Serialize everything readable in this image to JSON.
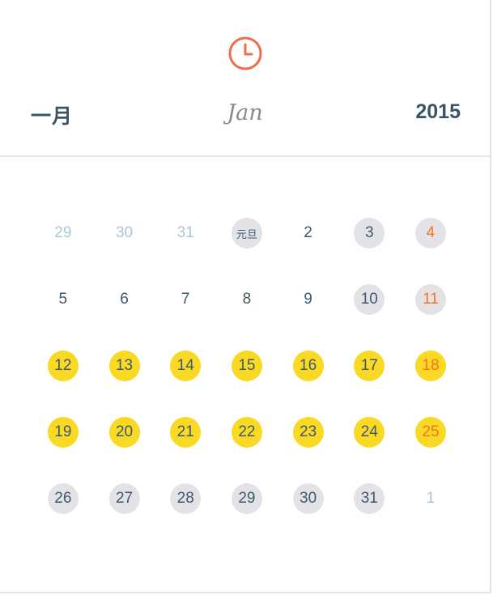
{
  "header": {
    "icon": "clock-icon",
    "month_cn": "一月",
    "month_en": "Jan",
    "year": "2015"
  },
  "colors": {
    "accent": "#f26b4a",
    "text": "#3a5566",
    "muted": "#a9c8d3",
    "highlight_yellow": "#f9d923",
    "grey_circle": "#e3e3e7",
    "weekend_orange": "#f5741f"
  },
  "calendar": {
    "weeks": [
      [
        {
          "label": "29",
          "type": "other"
        },
        {
          "label": "30",
          "type": "other"
        },
        {
          "label": "31",
          "type": "other"
        },
        {
          "label": "元旦",
          "type": "holiday"
        },
        {
          "label": "2",
          "type": "plain"
        },
        {
          "label": "3",
          "type": "grey"
        },
        {
          "label": "4",
          "type": "grey-weekend"
        }
      ],
      [
        {
          "label": "5",
          "type": "plain"
        },
        {
          "label": "6",
          "type": "plain"
        },
        {
          "label": "7",
          "type": "plain"
        },
        {
          "label": "8",
          "type": "plain"
        },
        {
          "label": "9",
          "type": "plain"
        },
        {
          "label": "10",
          "type": "grey"
        },
        {
          "label": "11",
          "type": "grey-weekend"
        }
      ],
      [
        {
          "label": "12",
          "type": "yellow"
        },
        {
          "label": "13",
          "type": "yellow"
        },
        {
          "label": "14",
          "type": "yellow"
        },
        {
          "label": "15",
          "type": "yellow"
        },
        {
          "label": "16",
          "type": "yellow"
        },
        {
          "label": "17",
          "type": "yellow"
        },
        {
          "label": "18",
          "type": "yellow-weekend"
        }
      ],
      [
        {
          "label": "19",
          "type": "yellow"
        },
        {
          "label": "20",
          "type": "yellow"
        },
        {
          "label": "21",
          "type": "yellow"
        },
        {
          "label": "22",
          "type": "yellow"
        },
        {
          "label": "23",
          "type": "yellow"
        },
        {
          "label": "24",
          "type": "yellow"
        },
        {
          "label": "25",
          "type": "yellow-weekend"
        }
      ],
      [
        {
          "label": "26",
          "type": "grey"
        },
        {
          "label": "27",
          "type": "grey"
        },
        {
          "label": "28",
          "type": "grey"
        },
        {
          "label": "29",
          "type": "grey"
        },
        {
          "label": "30",
          "type": "grey"
        },
        {
          "label": "31",
          "type": "grey"
        },
        {
          "label": "1",
          "type": "other"
        }
      ]
    ]
  }
}
